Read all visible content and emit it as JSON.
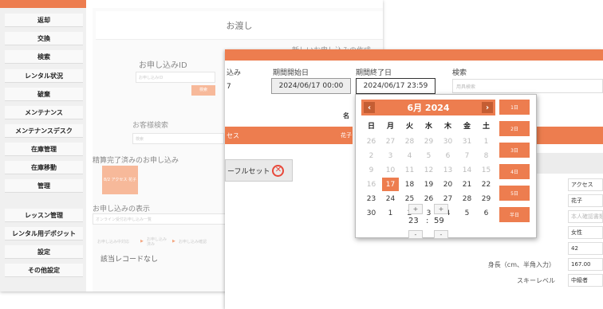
{
  "sidebar": {
    "items": [
      "返却",
      "交換",
      "検索",
      "レンタル状況",
      "破棄",
      "メンテナンス",
      "メンテナンスデスク",
      "在庫管理",
      "在庫移動",
      "管理",
      "レッスン管理",
      "レンタル用デポジット",
      "設定",
      "その他設定"
    ]
  },
  "back": {
    "header": "お渡し",
    "new_request": "新しいお申し込みの作成",
    "request_id_label": "お申し込みID",
    "request_id_placeholder": "お申し込みID",
    "search_btn": "検索",
    "customer_search_label": "お客様検索",
    "customer_search_placeholder": "検索",
    "completed_label": "精算完了済みのお申し込み",
    "completed_tile": "8/2 アクセス 花子",
    "display_label": "お申し込みの表示",
    "display_placeholder": "オンライン受付お申し込み一覧",
    "steps": [
      "お申し込み中対応",
      "お申し込み済み",
      "お申し込み確認"
    ],
    "no_record": "該当レコードなし"
  },
  "front": {
    "col_partial": "込み",
    "id_partial": "7",
    "period_start_label": "期間開始日",
    "period_start_value": "2024/06/17 00:00",
    "period_end_label": "期間終了日",
    "period_end_value": "2024/06/17 23:59",
    "search_label": "検索",
    "search_placeholder": "用具検索",
    "name_header": "名",
    "name_cut": "花子",
    "result_cut": "セス",
    "reset_label": "ーフルセット",
    "details": [
      {
        "label": "",
        "value": "アクセス",
        "placeholder": false
      },
      {
        "label": "",
        "value": "花子",
        "placeholder": false
      },
      {
        "label": "",
        "value": "本人確認書類",
        "placeholder": true
      },
      {
        "label": "",
        "value": "女性",
        "placeholder": false
      },
      {
        "label": "",
        "value": "42",
        "placeholder": false
      },
      {
        "label": "身長（cm、半角入力）",
        "value": "167.00",
        "placeholder": false
      },
      {
        "label": "スキーレベル",
        "value": "中級者",
        "placeholder": false
      }
    ]
  },
  "picker": {
    "month_label": "6月 2024",
    "prev": "‹",
    "next": "›",
    "weekdays": [
      "日",
      "月",
      "火",
      "水",
      "木",
      "金",
      "土"
    ],
    "weeks": [
      [
        {
          "d": "26",
          "o": true
        },
        {
          "d": "27",
          "o": true
        },
        {
          "d": "28",
          "o": true
        },
        {
          "d": "29",
          "o": true
        },
        {
          "d": "30",
          "o": true
        },
        {
          "d": "31",
          "o": true
        },
        {
          "d": "1",
          "o": true
        }
      ],
      [
        {
          "d": "2",
          "o": true
        },
        {
          "d": "3",
          "o": true
        },
        {
          "d": "4",
          "o": true
        },
        {
          "d": "5",
          "o": true
        },
        {
          "d": "6",
          "o": true
        },
        {
          "d": "7",
          "o": true
        },
        {
          "d": "8",
          "o": true
        }
      ],
      [
        {
          "d": "9",
          "o": true
        },
        {
          "d": "10",
          "o": true
        },
        {
          "d": "11",
          "o": true
        },
        {
          "d": "12",
          "o": true
        },
        {
          "d": "13",
          "o": true
        },
        {
          "d": "14",
          "o": true
        },
        {
          "d": "15",
          "o": true
        }
      ],
      [
        {
          "d": "16",
          "o": true
        },
        {
          "d": "17",
          "s": true
        },
        {
          "d": "18"
        },
        {
          "d": "19"
        },
        {
          "d": "20"
        },
        {
          "d": "21"
        },
        {
          "d": "22"
        }
      ],
      [
        {
          "d": "23"
        },
        {
          "d": "24"
        },
        {
          "d": "25"
        },
        {
          "d": "26"
        },
        {
          "d": "27"
        },
        {
          "d": "28"
        },
        {
          "d": "29"
        }
      ],
      [
        {
          "d": "30"
        },
        {
          "d": "1"
        },
        {
          "d": "2"
        },
        {
          "d": "3"
        },
        {
          "d": "4"
        },
        {
          "d": "5"
        },
        {
          "d": "6"
        }
      ]
    ],
    "hour": "23",
    "minute": "59",
    "sep": ":",
    "plus": "+",
    "minus": "-",
    "quick": [
      "1日",
      "2日",
      "3日",
      "4日",
      "5日",
      "半日"
    ],
    "accent": "#ed7d4f"
  }
}
